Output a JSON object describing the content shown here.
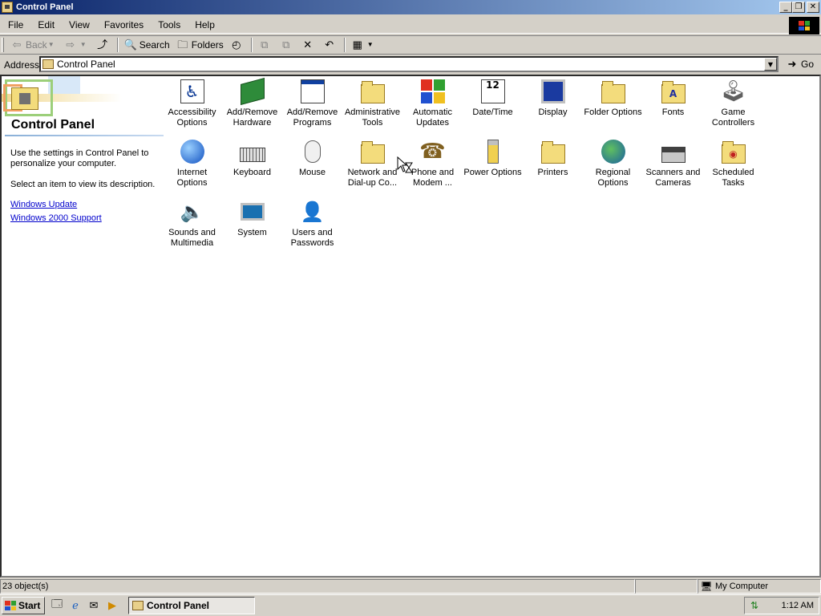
{
  "window": {
    "title": "Control Panel"
  },
  "menu": [
    "File",
    "Edit",
    "View",
    "Favorites",
    "Tools",
    "Help"
  ],
  "toolbar": {
    "back": "Back",
    "search": "Search",
    "folders": "Folders"
  },
  "address": {
    "label": "Address",
    "value": "Control Panel",
    "go": "Go"
  },
  "leftpane": {
    "title": "Control Panel",
    "desc1": "Use the settings in Control Panel to personalize your computer.",
    "desc2": "Select an item to view its description.",
    "link1": "Windows Update",
    "link2": "Windows 2000 Support"
  },
  "items": [
    {
      "label": "Accessibility Options",
      "icon": "accessibility-icon"
    },
    {
      "label": "Add/Remove Hardware",
      "icon": "hardware-icon"
    },
    {
      "label": "Add/Remove Programs",
      "icon": "programs-icon"
    },
    {
      "label": "Administrative Tools",
      "icon": "admin-tools-icon"
    },
    {
      "label": "Automatic Updates",
      "icon": "updates-icon"
    },
    {
      "label": "Date/Time",
      "icon": "date-time-icon"
    },
    {
      "label": "Display",
      "icon": "display-icon"
    },
    {
      "label": "Folder Options",
      "icon": "folder-options-icon"
    },
    {
      "label": "Fonts",
      "icon": "fonts-icon"
    },
    {
      "label": "Game Controllers",
      "icon": "joystick-icon"
    },
    {
      "label": "Internet Options",
      "icon": "internet-icon"
    },
    {
      "label": "Keyboard",
      "icon": "keyboard-icon"
    },
    {
      "label": "Mouse",
      "icon": "mouse-icon"
    },
    {
      "label": "Network and Dial-up Co...",
      "icon": "network-icon"
    },
    {
      "label": "Phone and Modem ...",
      "icon": "phone-icon"
    },
    {
      "label": "Power Options",
      "icon": "power-icon"
    },
    {
      "label": "Printers",
      "icon": "printers-icon"
    },
    {
      "label": "Regional Options",
      "icon": "globe-icon"
    },
    {
      "label": "Scanners and Cameras",
      "icon": "scanner-icon"
    },
    {
      "label": "Scheduled Tasks",
      "icon": "scheduled-tasks-icon"
    },
    {
      "label": "Sounds and Multimedia",
      "icon": "speaker-icon"
    },
    {
      "label": "System",
      "icon": "computer-icon"
    },
    {
      "label": "Users and Passwords",
      "icon": "users-icon"
    }
  ],
  "status": {
    "count": "23 object(s)",
    "location": "My Computer"
  },
  "taskbar": {
    "start": "Start",
    "task": "Control Panel",
    "clock": "1:12 AM"
  }
}
